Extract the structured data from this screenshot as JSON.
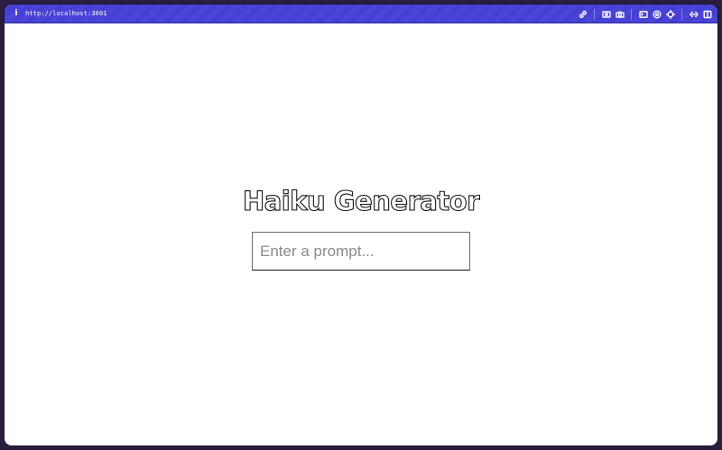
{
  "browser": {
    "url": "http://localhost:3001",
    "icons": [
      "info-icon",
      "link-icon",
      "screenshot-icon",
      "camera-icon",
      "terminal-icon",
      "globe-icon",
      "crosshair-icon",
      "code-icon",
      "sidebar-icon"
    ]
  },
  "page": {
    "title": "Haiku Generator",
    "prompt": {
      "placeholder": "Enter a prompt...",
      "value": ""
    }
  },
  "colors": {
    "toolbar": "#4a44d8",
    "page_background": "#ffffff",
    "outer_background": "#2b1d3f"
  }
}
